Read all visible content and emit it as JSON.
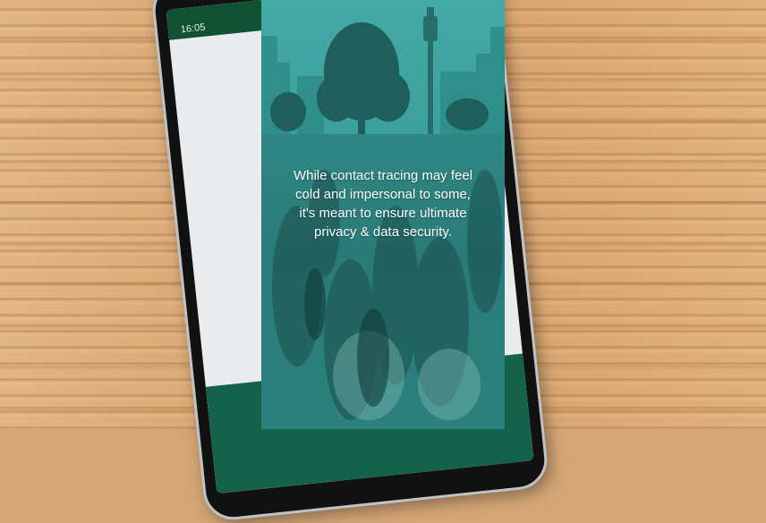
{
  "phone": {
    "status_time": "16:05"
  },
  "panel": {
    "caption": "While contact tracing may feel cold and impersonal to some, it's meant to ensure ultimate privacy & data security."
  },
  "colors": {
    "teal_tint": "#3a9e9a",
    "wood": "#d9a874",
    "phone_app_green": "#14624a"
  }
}
